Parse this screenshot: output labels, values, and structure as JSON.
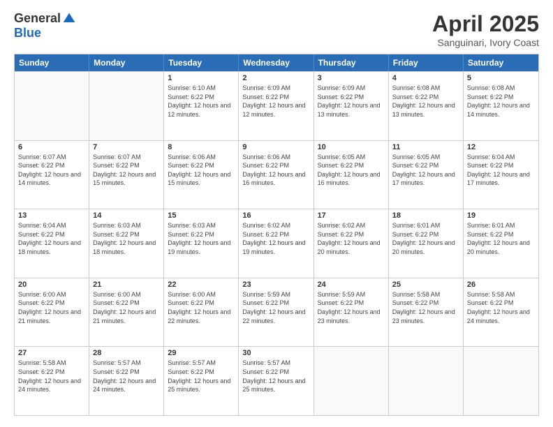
{
  "logo": {
    "general": "General",
    "blue": "Blue"
  },
  "title": "April 2025",
  "subtitle": "Sanguinari, Ivory Coast",
  "days": [
    "Sunday",
    "Monday",
    "Tuesday",
    "Wednesday",
    "Thursday",
    "Friday",
    "Saturday"
  ],
  "weeks": [
    [
      {
        "day": "",
        "info": ""
      },
      {
        "day": "",
        "info": ""
      },
      {
        "day": "1",
        "info": "Sunrise: 6:10 AM\nSunset: 6:22 PM\nDaylight: 12 hours and 12 minutes."
      },
      {
        "day": "2",
        "info": "Sunrise: 6:09 AM\nSunset: 6:22 PM\nDaylight: 12 hours and 12 minutes."
      },
      {
        "day": "3",
        "info": "Sunrise: 6:09 AM\nSunset: 6:22 PM\nDaylight: 12 hours and 13 minutes."
      },
      {
        "day": "4",
        "info": "Sunrise: 6:08 AM\nSunset: 6:22 PM\nDaylight: 12 hours and 13 minutes."
      },
      {
        "day": "5",
        "info": "Sunrise: 6:08 AM\nSunset: 6:22 PM\nDaylight: 12 hours and 14 minutes."
      }
    ],
    [
      {
        "day": "6",
        "info": "Sunrise: 6:07 AM\nSunset: 6:22 PM\nDaylight: 12 hours and 14 minutes."
      },
      {
        "day": "7",
        "info": "Sunrise: 6:07 AM\nSunset: 6:22 PM\nDaylight: 12 hours and 15 minutes."
      },
      {
        "day": "8",
        "info": "Sunrise: 6:06 AM\nSunset: 6:22 PM\nDaylight: 12 hours and 15 minutes."
      },
      {
        "day": "9",
        "info": "Sunrise: 6:06 AM\nSunset: 6:22 PM\nDaylight: 12 hours and 16 minutes."
      },
      {
        "day": "10",
        "info": "Sunrise: 6:05 AM\nSunset: 6:22 PM\nDaylight: 12 hours and 16 minutes."
      },
      {
        "day": "11",
        "info": "Sunrise: 6:05 AM\nSunset: 6:22 PM\nDaylight: 12 hours and 17 minutes."
      },
      {
        "day": "12",
        "info": "Sunrise: 6:04 AM\nSunset: 6:22 PM\nDaylight: 12 hours and 17 minutes."
      }
    ],
    [
      {
        "day": "13",
        "info": "Sunrise: 6:04 AM\nSunset: 6:22 PM\nDaylight: 12 hours and 18 minutes."
      },
      {
        "day": "14",
        "info": "Sunrise: 6:03 AM\nSunset: 6:22 PM\nDaylight: 12 hours and 18 minutes."
      },
      {
        "day": "15",
        "info": "Sunrise: 6:03 AM\nSunset: 6:22 PM\nDaylight: 12 hours and 19 minutes."
      },
      {
        "day": "16",
        "info": "Sunrise: 6:02 AM\nSunset: 6:22 PM\nDaylight: 12 hours and 19 minutes."
      },
      {
        "day": "17",
        "info": "Sunrise: 6:02 AM\nSunset: 6:22 PM\nDaylight: 12 hours and 20 minutes."
      },
      {
        "day": "18",
        "info": "Sunrise: 6:01 AM\nSunset: 6:22 PM\nDaylight: 12 hours and 20 minutes."
      },
      {
        "day": "19",
        "info": "Sunrise: 6:01 AM\nSunset: 6:22 PM\nDaylight: 12 hours and 20 minutes."
      }
    ],
    [
      {
        "day": "20",
        "info": "Sunrise: 6:00 AM\nSunset: 6:22 PM\nDaylight: 12 hours and 21 minutes."
      },
      {
        "day": "21",
        "info": "Sunrise: 6:00 AM\nSunset: 6:22 PM\nDaylight: 12 hours and 21 minutes."
      },
      {
        "day": "22",
        "info": "Sunrise: 6:00 AM\nSunset: 6:22 PM\nDaylight: 12 hours and 22 minutes."
      },
      {
        "day": "23",
        "info": "Sunrise: 5:59 AM\nSunset: 6:22 PM\nDaylight: 12 hours and 22 minutes."
      },
      {
        "day": "24",
        "info": "Sunrise: 5:59 AM\nSunset: 6:22 PM\nDaylight: 12 hours and 23 minutes."
      },
      {
        "day": "25",
        "info": "Sunrise: 5:58 AM\nSunset: 6:22 PM\nDaylight: 12 hours and 23 minutes."
      },
      {
        "day": "26",
        "info": "Sunrise: 5:58 AM\nSunset: 6:22 PM\nDaylight: 12 hours and 24 minutes."
      }
    ],
    [
      {
        "day": "27",
        "info": "Sunrise: 5:58 AM\nSunset: 6:22 PM\nDaylight: 12 hours and 24 minutes."
      },
      {
        "day": "28",
        "info": "Sunrise: 5:57 AM\nSunset: 6:22 PM\nDaylight: 12 hours and 24 minutes."
      },
      {
        "day": "29",
        "info": "Sunrise: 5:57 AM\nSunset: 6:22 PM\nDaylight: 12 hours and 25 minutes."
      },
      {
        "day": "30",
        "info": "Sunrise: 5:57 AM\nSunset: 6:22 PM\nDaylight: 12 hours and 25 minutes."
      },
      {
        "day": "",
        "info": ""
      },
      {
        "day": "",
        "info": ""
      },
      {
        "day": "",
        "info": ""
      }
    ]
  ]
}
